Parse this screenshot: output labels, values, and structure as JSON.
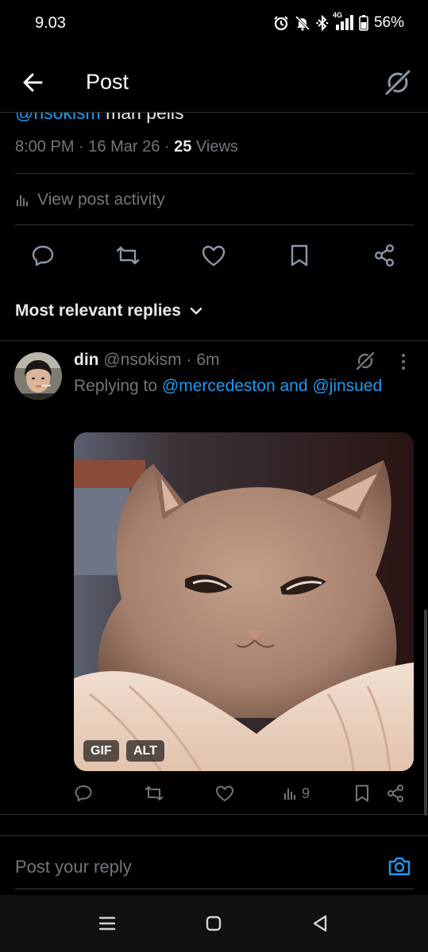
{
  "status_bar": {
    "time": "9.03",
    "network": "4G",
    "battery": "56%",
    "icons": [
      "alarm-icon",
      "mute-icon",
      "bluetooth-icon",
      "signal-icon",
      "battery-icon"
    ]
  },
  "header": {
    "title": "Post",
    "back_icon": "arrow-left-icon",
    "grok_icon": "grok-icon"
  },
  "post": {
    "partial_text_mention": "@nsokism",
    "partial_text_rest": " man pells",
    "time": "8:00 PM",
    "date": "16 Mar 26",
    "views_count": "25",
    "views_label": " Views",
    "activity_label": "View post activity"
  },
  "post_actions": [
    "reply-icon",
    "repost-icon",
    "like-icon",
    "bookmark-icon",
    "share-icon"
  ],
  "replies_sort": {
    "label": "Most relevant replies"
  },
  "reply": {
    "name": "din",
    "handle": "@nsokism",
    "time": "6m",
    "replying_prefix": "Replying to ",
    "replying_to_1": "@mercedeston",
    "replying_and": " and ",
    "replying_to_2": "@jinsued",
    "media_badges": {
      "gif": "GIF",
      "alt": "ALT"
    },
    "views_count": "9"
  },
  "composer": {
    "placeholder": "Post your reply"
  },
  "colors": {
    "background": "#000000",
    "accent": "#1d9bf0",
    "text_primary": "#e7e9ea",
    "text_secondary": "#71767b",
    "divider": "#2f3336"
  }
}
